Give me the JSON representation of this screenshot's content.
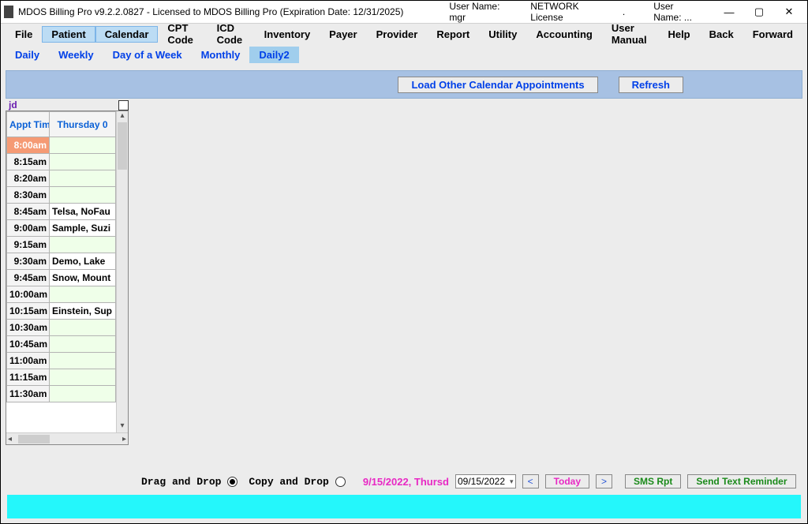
{
  "titlebar": {
    "title": "MDOS Billing Pro v9.2.2.0827 - Licensed to MDOS Billing Pro (Expiration Date: 12/31/2025)",
    "user_label": "User Name: mgr",
    "license": "NETWORK License",
    "dot": ".",
    "user2_label": "User Name: ..."
  },
  "menubar": [
    "File",
    "Patient",
    "Calendar",
    "CPT Code",
    "ICD Code",
    "Inventory",
    "Payer",
    "Provider",
    "Report",
    "Utility",
    "Accounting",
    "User Manual",
    "Help",
    "Back",
    "Forward"
  ],
  "tabs": [
    "Daily",
    "Weekly",
    "Day of a Week",
    "Monthly",
    "Daily2"
  ],
  "active_tab": "Daily2",
  "toolbar": {
    "load": "Load Other Calendar Appointments",
    "refresh": "Refresh"
  },
  "user_code": "jd",
  "grid": {
    "headers": [
      "Appt Time",
      "Thursday 0"
    ],
    "rows": [
      {
        "time": "8:00am",
        "val": "",
        "hl": true
      },
      {
        "time": "8:15am",
        "val": ""
      },
      {
        "time": "8:20am",
        "val": ""
      },
      {
        "time": "8:30am",
        "val": ""
      },
      {
        "time": "8:45am",
        "val": "Telsa, NoFau"
      },
      {
        "time": "9:00am",
        "val": "Sample, Suzi"
      },
      {
        "time": "9:15am",
        "val": ""
      },
      {
        "time": "9:30am",
        "val": "Demo, Lake"
      },
      {
        "time": "9:45am",
        "val": "Snow, Mount"
      },
      {
        "time": "10:00am",
        "val": ""
      },
      {
        "time": "10:15am",
        "val": "Einstein, Sup"
      },
      {
        "time": "10:30am",
        "val": ""
      },
      {
        "time": "10:45am",
        "val": ""
      },
      {
        "time": "11:00am",
        "val": ""
      },
      {
        "time": "11:15am",
        "val": ""
      },
      {
        "time": "11:30am",
        "val": ""
      }
    ]
  },
  "bottom": {
    "drag": "Drag and Drop",
    "copy": "Copy and Drop",
    "date_text": "9/15/2022, Thursd",
    "date_value": "09/15/2022",
    "prev": "<",
    "today": "Today",
    "next": ">",
    "sms": "SMS Rpt",
    "send": "Send Text Reminder"
  }
}
